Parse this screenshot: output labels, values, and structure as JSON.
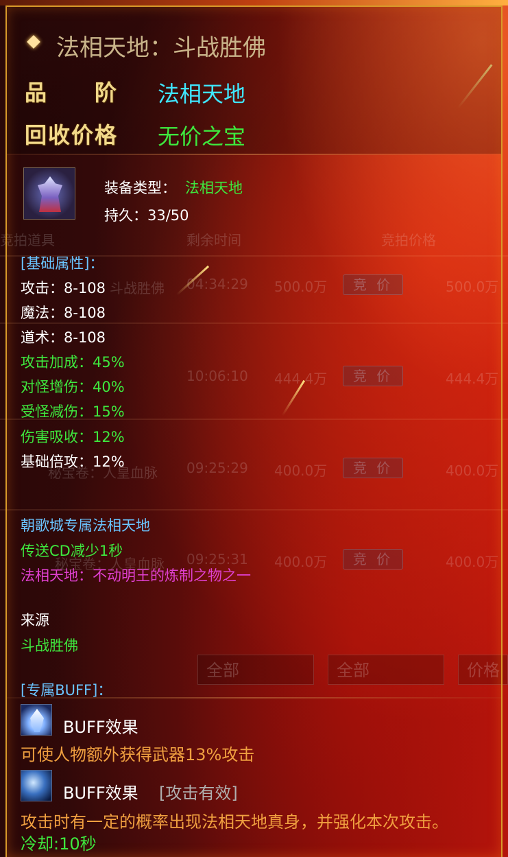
{
  "header": {
    "title": "法相天地：斗战胜佛",
    "grade_label": "品　　阶",
    "grade_value": "法相天地",
    "recycle_label": "回收价格",
    "recycle_value": "无价之宝"
  },
  "item": {
    "icon": "warrior-figure-icon",
    "type_label": "装备类型：",
    "type_value": "法相天地",
    "durability": "持久：33/50"
  },
  "base_attributes": {
    "heading": "[基础属性]：",
    "white": [
      "攻击：8-108",
      "魔法：8-108",
      "道术：8-108"
    ],
    "green": [
      "攻击加成：45%",
      "对怪增伤：40%",
      "受怪减伤：15%",
      "伤害吸收：12%"
    ],
    "multiplier": "基础倍攻：12%"
  },
  "notes": {
    "exclusive": "朝歌城专属法相天地",
    "teleport": "传送CD减少1秒",
    "lore": "法相天地：不动明王的炼制之物之一"
  },
  "source": {
    "label": "来源",
    "value": "斗战胜佛"
  },
  "buff": {
    "heading": "[专属BUFF]：",
    "entries": [
      {
        "icon": "crystal-icon",
        "name": "BUFF效果",
        "tag": "",
        "desc": "可使人物额外获得武器13%攻击"
      },
      {
        "icon": "warrior-skill-icon",
        "name": "BUFF效果",
        "tag": "[攻击有效]",
        "desc": "攻击时有一定的概率出现法相天地真身，并强化本次攻击。"
      }
    ],
    "cooldown": "冷却:10秒"
  },
  "background_auction": {
    "col_item": "竞拍道具",
    "col_time": "剩余时间",
    "col_price": "竞拍价格",
    "bid_label": "竞 价",
    "rows": [
      {
        "name": "斗战胜佛",
        "time": "04:34:29",
        "price": "500.0万",
        "max": "500.0万"
      },
      {
        "name": "",
        "time": "10:06:10",
        "price": "444.4万",
        "max": "444.4万"
      },
      {
        "name": "秘宝卷：人皇血脉",
        "time": "09:25:29",
        "price": "400.0万",
        "max": "400.0万"
      },
      {
        "name": "秘宝卷：人皇血脉",
        "time": "09:25:31",
        "price": "400.0万",
        "max": "400.0万"
      }
    ],
    "filter1": "全部",
    "filter2": "全部",
    "filter3": "价格"
  },
  "colors": {
    "frame": "#d89a2a",
    "label_gold": "#f2d98a",
    "cyan": "#3fe6ff",
    "green": "#3ee83e",
    "blue": "#6ac4ff",
    "magenta": "#e040d0",
    "orange": "#f0a040"
  }
}
